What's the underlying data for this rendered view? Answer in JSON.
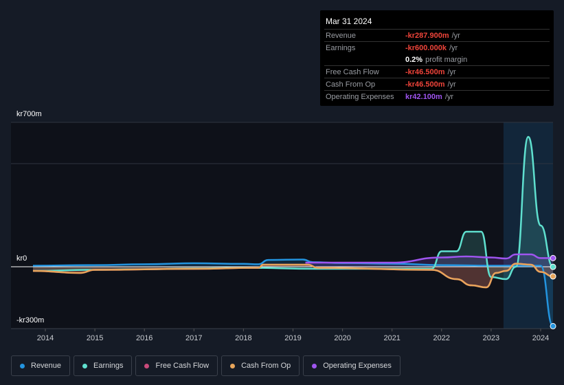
{
  "tooltip": {
    "date": "Mar 31 2024",
    "rows": [
      {
        "label": "Revenue",
        "value": "-kr287.900m",
        "unit": "/yr",
        "cls": "neg"
      },
      {
        "label": "Earnings",
        "value": "-kr600.000k",
        "unit": "/yr",
        "cls": "neg"
      },
      {
        "label": "",
        "value": "0.2%",
        "unit": "profit margin",
        "cls": "wht"
      },
      {
        "label": "Free Cash Flow",
        "value": "-kr46.500m",
        "unit": "/yr",
        "cls": "neg"
      },
      {
        "label": "Cash From Op",
        "value": "-kr46.500m",
        "unit": "/yr",
        "cls": "neg"
      },
      {
        "label": "Operating Expenses",
        "value": "kr42.100m",
        "unit": "/yr",
        "cls": "pur"
      }
    ]
  },
  "chart_data": {
    "type": "line",
    "ylim": [
      -300,
      700
    ],
    "xlim": [
      2013.8,
      2024.25
    ],
    "y_tick_labels": [
      "kr700m",
      "kr0",
      "-kr300m"
    ],
    "x_tick_labels": [
      "2014",
      "2015",
      "2016",
      "2017",
      "2018",
      "2019",
      "2020",
      "2021",
      "2022",
      "2023",
      "2024"
    ],
    "forecast_shade_from": 2023.25,
    "series": [
      {
        "name": "Revenue",
        "color": "#2394df",
        "points": [
          [
            2013.75,
            5
          ],
          [
            2015,
            8
          ],
          [
            2016,
            12
          ],
          [
            2017,
            17
          ],
          [
            2018,
            14
          ],
          [
            2018.3,
            12
          ],
          [
            2018.5,
            33
          ],
          [
            2019.2,
            35
          ],
          [
            2019.4,
            22
          ],
          [
            2020,
            18
          ],
          [
            2021,
            15
          ],
          [
            2022,
            8
          ],
          [
            2023,
            5
          ],
          [
            2024,
            5
          ],
          [
            2024.25,
            -288
          ]
        ]
      },
      {
        "name": "Earnings",
        "color": "#5fe0cf",
        "points": [
          [
            2013.75,
            -20
          ],
          [
            2015,
            -15
          ],
          [
            2016,
            -12
          ],
          [
            2017,
            -8
          ],
          [
            2018,
            -5
          ],
          [
            2019.5,
            -10
          ],
          [
            2021.8,
            -10
          ],
          [
            2022,
            75
          ],
          [
            2022.3,
            75
          ],
          [
            2022.5,
            170
          ],
          [
            2022.8,
            170
          ],
          [
            2023,
            -50
          ],
          [
            2023.3,
            -60
          ],
          [
            2023.5,
            0
          ],
          [
            2023.75,
            630
          ],
          [
            2024,
            200
          ],
          [
            2024.25,
            -0.6
          ]
        ]
      },
      {
        "name": "Free Cash Flow",
        "color": "#c94a7a",
        "points": [
          [
            2013.75,
            -20
          ],
          [
            2014.7,
            -30
          ],
          [
            2015,
            -15
          ],
          [
            2017,
            -10
          ],
          [
            2018.3,
            -5
          ],
          [
            2018.4,
            10
          ],
          [
            2019.3,
            10
          ],
          [
            2019.5,
            -5
          ],
          [
            2021.8,
            -15
          ],
          [
            2022.3,
            -60
          ],
          [
            2022.6,
            -90
          ],
          [
            2022.9,
            -100
          ],
          [
            2023.1,
            -30
          ],
          [
            2023.3,
            -20
          ],
          [
            2023.5,
            15
          ],
          [
            2023.8,
            10
          ],
          [
            2024,
            -25
          ],
          [
            2024.25,
            -46.5
          ]
        ]
      },
      {
        "name": "Cash From Op",
        "color": "#e8a55a",
        "points": [
          [
            2013.75,
            -20
          ],
          [
            2014.7,
            -30
          ],
          [
            2015,
            -15
          ],
          [
            2017,
            -10
          ],
          [
            2018.3,
            -5
          ],
          [
            2018.4,
            10
          ],
          [
            2019.3,
            10
          ],
          [
            2019.5,
            -5
          ],
          [
            2021.8,
            -15
          ],
          [
            2022.3,
            -60
          ],
          [
            2022.6,
            -90
          ],
          [
            2022.9,
            -100
          ],
          [
            2023.1,
            -30
          ],
          [
            2023.3,
            -20
          ],
          [
            2023.5,
            15
          ],
          [
            2023.8,
            10
          ],
          [
            2024,
            -25
          ],
          [
            2024.25,
            -46.5
          ]
        ]
      },
      {
        "name": "Operating Expenses",
        "color": "#9f55f0",
        "points": [
          [
            2019.25,
            20
          ],
          [
            2021,
            20
          ],
          [
            2022,
            45
          ],
          [
            2022.5,
            50
          ],
          [
            2023,
            45
          ],
          [
            2023.3,
            40
          ],
          [
            2023.5,
            60
          ],
          [
            2023.8,
            60
          ],
          [
            2024,
            42
          ],
          [
            2024.25,
            42.1
          ]
        ]
      }
    ]
  }
}
